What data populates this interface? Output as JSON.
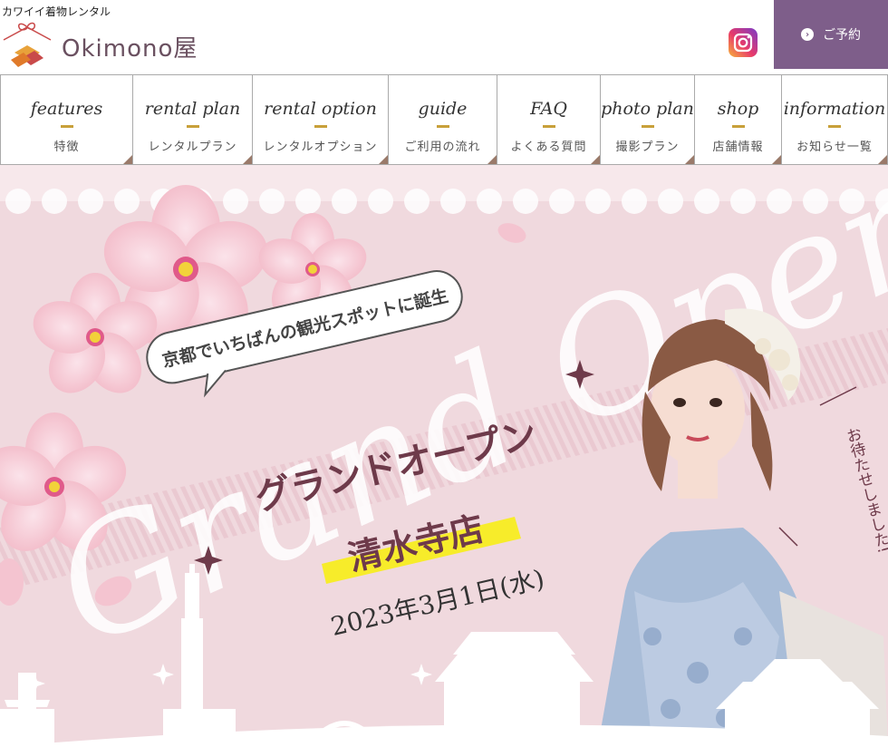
{
  "header": {
    "tagline": "カワイイ着物レンタル",
    "logo_text": "Okimono屋",
    "reserve_label": "ご予約"
  },
  "nav": [
    {
      "en": "features",
      "ja": "特徴"
    },
    {
      "en": "rental plan",
      "ja": "レンタルプラン"
    },
    {
      "en": "rental option",
      "ja": "レンタルオプション"
    },
    {
      "en": "guide",
      "ja": "ご利用の流れ"
    },
    {
      "en": "FAQ",
      "ja": "よくある質問"
    },
    {
      "en": "photo plan",
      "ja": "撮影プラン"
    },
    {
      "en": "shop",
      "ja": "店舗情報"
    },
    {
      "en": "information",
      "ja": "お知らせ一覧"
    }
  ],
  "hero": {
    "bubble_text": "京都でいちばんの観光スポットに誕生",
    "big_text": "Grand Open",
    "grand_open_ja": "グランドオープン",
    "store_name": "清水寺店",
    "date": "2023年3月1日(水)",
    "side_note": "お待たせしました!"
  },
  "colors": {
    "accent_purple": "#7e5e8a",
    "gold": "#c8a03a",
    "hero_pink": "#f0d9de",
    "text_maroon": "#6e3a4a",
    "highlight_yellow": "#f7ec2a"
  }
}
